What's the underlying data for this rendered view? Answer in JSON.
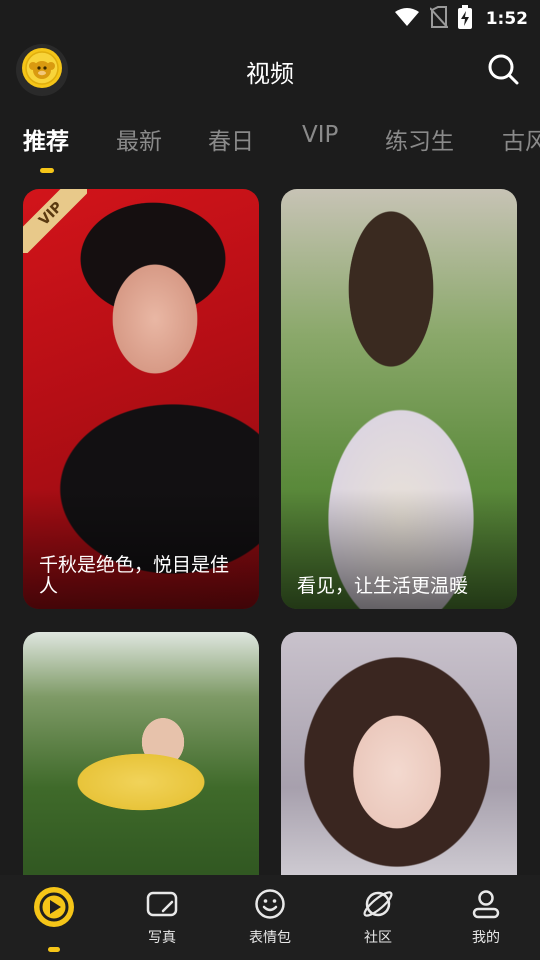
{
  "status_bar": {
    "time": "1:52",
    "icons": [
      "wifi-icon",
      "no-sim-icon",
      "battery-charging-icon"
    ]
  },
  "header": {
    "title": "视频",
    "avatar_icon": "monkey-coin-icon",
    "search_icon": "search-icon"
  },
  "tabs": [
    {
      "label": "推荐",
      "active": true
    },
    {
      "label": "最新",
      "active": false
    },
    {
      "label": "春日",
      "active": false
    },
    {
      "label": "VIP",
      "active": false
    },
    {
      "label": "练习生",
      "active": false
    },
    {
      "label": "古风",
      "active": false
    }
  ],
  "cards": [
    {
      "caption": "千秋是绝色，悦目是佳人",
      "badge": "VIP"
    },
    {
      "caption": "看见，让生活更温暖"
    },
    {
      "caption": ""
    },
    {
      "caption": ""
    }
  ],
  "bottom_nav": [
    {
      "label": "",
      "icon": "play-circle-icon",
      "active": true
    },
    {
      "label": "写真",
      "icon": "photo-card-icon",
      "active": false
    },
    {
      "label": "表情包",
      "icon": "smiley-icon",
      "active": false
    },
    {
      "label": "社区",
      "icon": "planet-icon",
      "active": false
    },
    {
      "label": "我的",
      "icon": "user-icon",
      "active": false
    }
  ],
  "colors": {
    "accent": "#f5c518",
    "background": "#1c1c1c",
    "tab_inactive": "#8a8a8a"
  }
}
